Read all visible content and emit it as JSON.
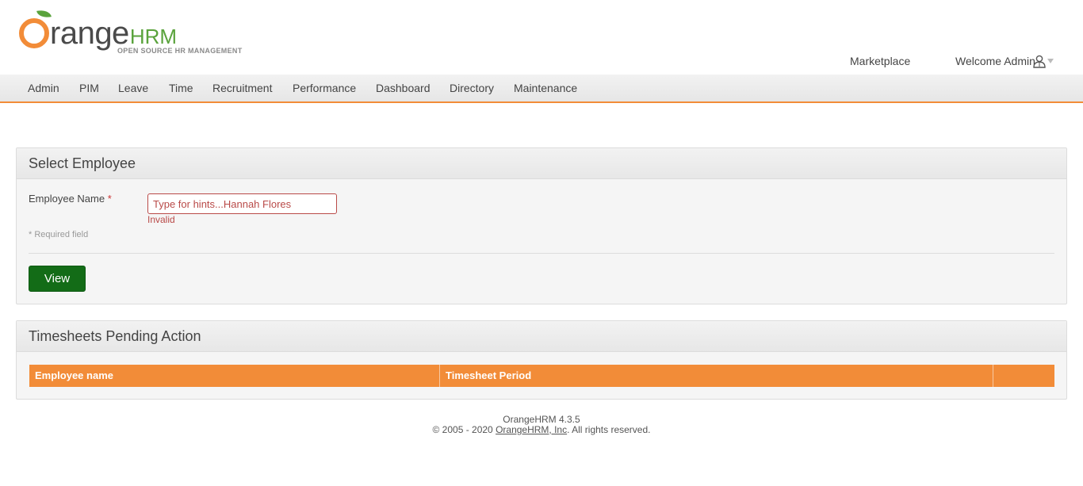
{
  "brand": {
    "logo_first": "O",
    "logo_rest": "range",
    "logo_hrm": "HRM",
    "tagline": "OPEN SOURCE HR MANAGEMENT",
    "colors": {
      "orange": "#f28c38",
      "green": "#5aa33c"
    }
  },
  "header": {
    "marketplace_label": "Marketplace",
    "welcome_label": "Welcome Admin",
    "user_icon": "user-icon",
    "caret_icon": "caret-down-icon"
  },
  "nav": {
    "items": [
      {
        "label": "Admin"
      },
      {
        "label": "PIM"
      },
      {
        "label": "Leave"
      },
      {
        "label": "Time"
      },
      {
        "label": "Recruitment"
      },
      {
        "label": "Performance"
      },
      {
        "label": "Dashboard"
      },
      {
        "label": "Directory"
      },
      {
        "label": "Maintenance"
      }
    ]
  },
  "select_employee": {
    "title": "Select Employee",
    "field_label": "Employee Name",
    "required_mark": "*",
    "input_value": "Type for hints...Hannah Flores",
    "error_text": "Invalid",
    "required_note": "* Required field",
    "view_button": "View",
    "colors": {
      "error": "#b94a48",
      "button": "#136c17"
    }
  },
  "pending": {
    "title": "Timesheets Pending Action",
    "columns": [
      "Employee name",
      "Timesheet Period",
      ""
    ],
    "header_color": "#f28c38"
  },
  "footer": {
    "version": "OrangeHRM 4.3.5",
    "copyright_prefix": "© 2005 - 2020",
    "company_link": "OrangeHRM, Inc",
    "copyright_suffix": ". All rights reserved."
  }
}
